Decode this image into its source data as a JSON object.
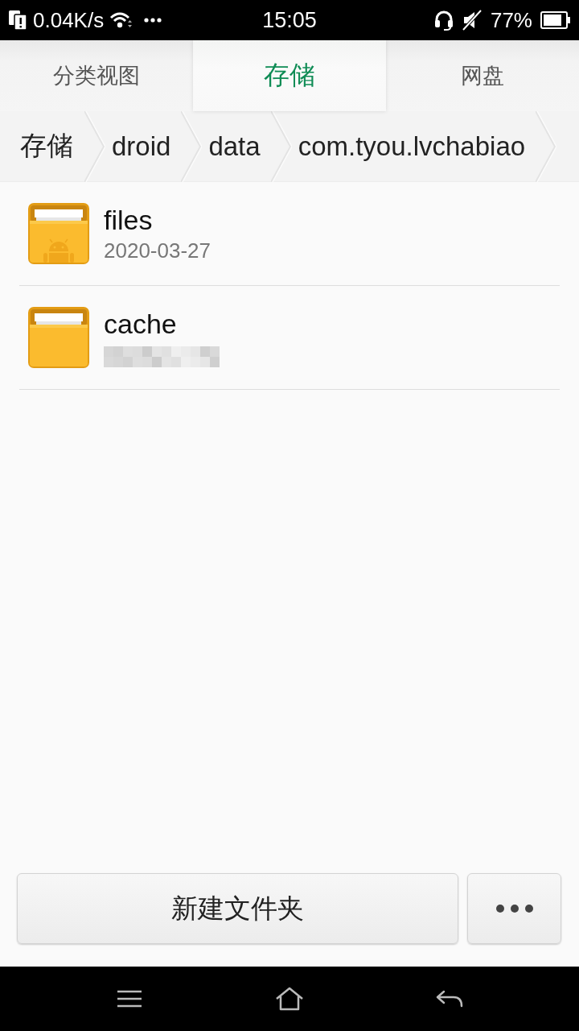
{
  "status_bar": {
    "net_speed": "0.04K/s",
    "time": "15:05",
    "battery": "77%"
  },
  "tabs": [
    {
      "label": "分类视图",
      "selected": false
    },
    {
      "label": "存储",
      "selected": true
    },
    {
      "label": "网盘",
      "selected": false
    }
  ],
  "breadcrumbs": [
    "存储",
    "droid",
    "data",
    "com.tyou.lvchabiao"
  ],
  "files": [
    {
      "name": "files",
      "kind": "android",
      "date": "2020-03-27",
      "date_obscured": false
    },
    {
      "name": "cache",
      "kind": "plain",
      "date_obscured": true
    }
  ],
  "buttons": {
    "new_folder": "新建文件夹"
  }
}
